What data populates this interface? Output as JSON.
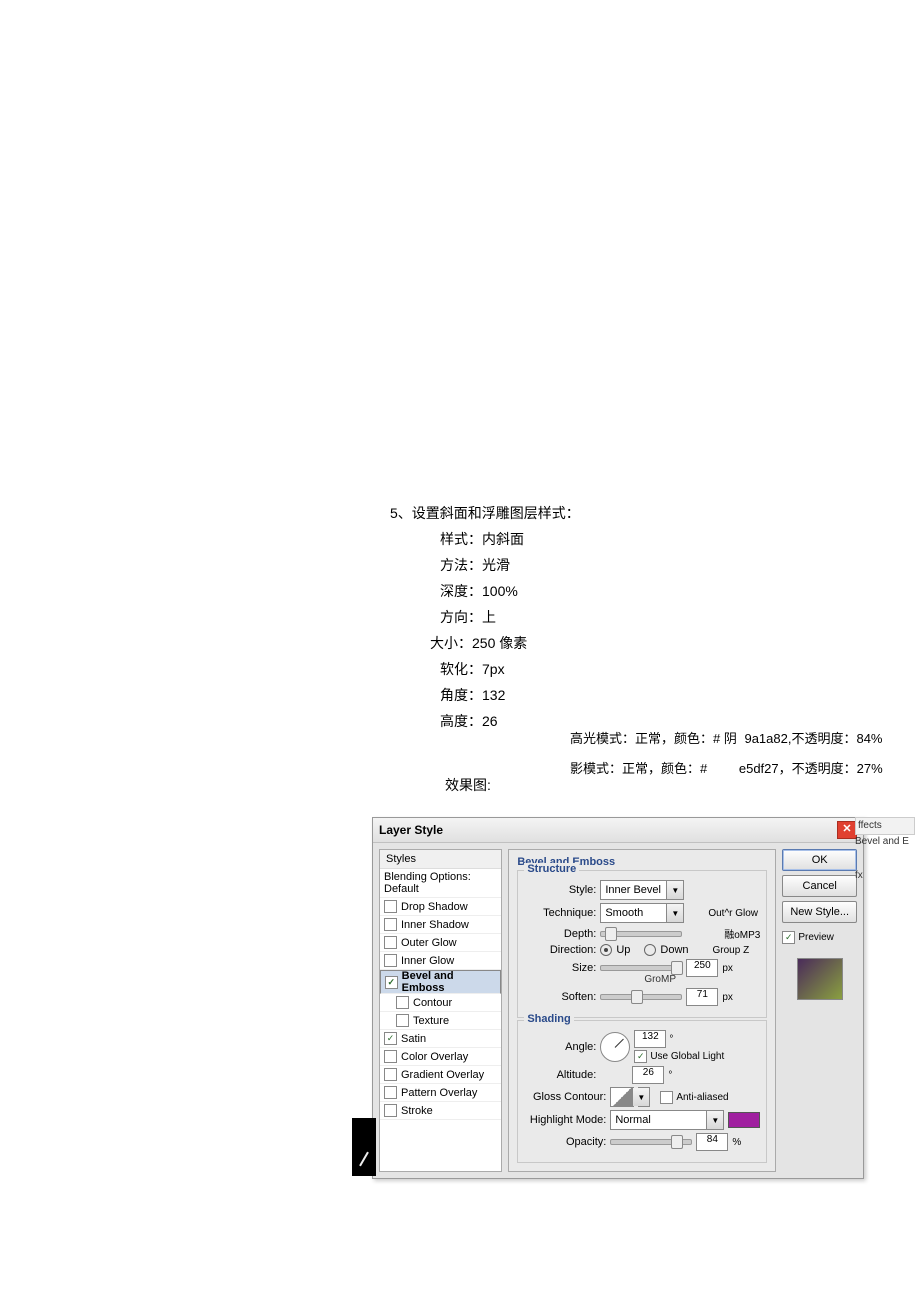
{
  "instructions": {
    "line0": "5、设置斜面和浮雕图层样式：",
    "line1": "样式：内斜面",
    "line2": "方法：光滑",
    "line3": "深度：100%",
    "line4": "方向：上",
    "line5": "大小：250 像素",
    "line6": "软化：7px",
    "line7": "角度：132",
    "line8": "高度：26"
  },
  "modes": {
    "highlight_left": "高光模式：正常，颜色：# 阴",
    "highlight_right": "9a1a82,不透明度：84%",
    "shadow_left": "影模式：正常，颜色：#",
    "shadow_right": "e5df27，不透明度：27%"
  },
  "effect_label": "效果图:",
  "dialog": {
    "title": "Layer Style",
    "ok": "OK",
    "cancel": "Cancel",
    "new_style": "New Style...",
    "preview": "Preview",
    "styles_header": "Styles",
    "styles": {
      "blending": "Blending Options: Default",
      "drop_shadow": "Drop Shadow",
      "inner_shadow": "Inner Shadow",
      "outer_glow": "Outer Glow",
      "inner_glow": "Inner Glow",
      "bevel": "Bevel and Emboss",
      "contour": "Contour",
      "texture": "Texture",
      "satin": "Satin",
      "color_overlay": "Color Overlay",
      "gradient_overlay": "Gradient Overlay",
      "pattern_overlay": "Pattern Overlay",
      "stroke": "Stroke"
    },
    "panel_title": "Bevel and Emboss",
    "structure": {
      "legend": "Structure",
      "style_label": "Style:",
      "style_value": "Inner Bevel",
      "technique_label": "Technique:",
      "technique_value": "Smooth",
      "outrglow": "Out^r Glow",
      "depth_label": "Depth:",
      "depth_suffix": "融oMP3",
      "direction_label": "Direction:",
      "dir_up": "Up",
      "dir_down": "Down",
      "groupz": "Group Z",
      "size_label": "Size:",
      "size_value": "250",
      "size_unit": "px",
      "gromp": "GroMP",
      "soften_label": "Soften:",
      "soften_value": "71",
      "soften_unit": "px"
    },
    "shading": {
      "legend": "Shading",
      "angle_label": "Angle:",
      "angle_value": "132",
      "angle_unit": "°",
      "use_global": "Use Global Light",
      "altitude_label": "Altitude:",
      "altitude_value": "26",
      "altitude_unit": "°",
      "gloss_label": "Gloss Contour:",
      "antialiased": "Anti-aliased",
      "highlight_label": "Highlight Mode:",
      "highlight_value": "Normal",
      "opacity_label": "Opacity:",
      "opacity_value": "84",
      "opacity_unit": "%"
    }
  },
  "fx": {
    "effects": "ffects",
    "bevel": "Bevel and E",
    "fx": "fx"
  }
}
